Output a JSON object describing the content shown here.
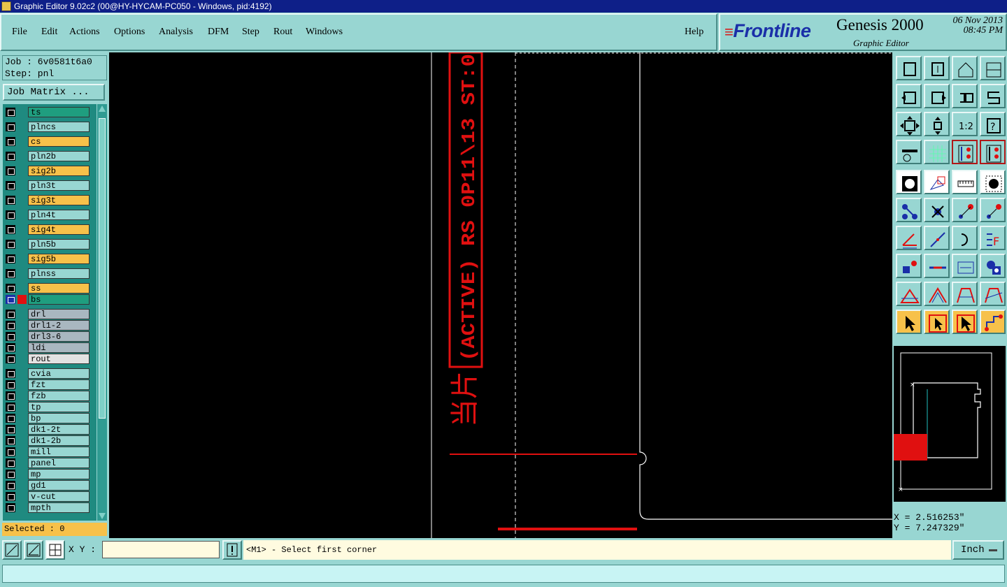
{
  "window": {
    "title": "Graphic Editor 9.02c2 (00@HY-HYCAM-PC050 - Windows, pid:4192)"
  },
  "menu": {
    "items": [
      "File",
      "Edit",
      "Actions",
      "Options",
      "Analysis",
      "DFM",
      "Step",
      "Rout",
      "Windows"
    ],
    "help": "Help"
  },
  "brand": {
    "logo": "Frontline",
    "product": "Genesis 2000",
    "date": "06 Nov 2013",
    "time": "08:45 PM",
    "subtitle": "Graphic Editor"
  },
  "job": {
    "job_label": "Job : 6v0581t6a0",
    "step_label": "Step: pnl",
    "matrix_button": "Job Matrix ..."
  },
  "layers": [
    {
      "name": "ts",
      "color": "#1f9e7f"
    },
    {
      "name": "plncs",
      "color": "#98d6d2"
    },
    {
      "name": "cs",
      "color": "#f7c14a"
    },
    {
      "name": "pln2b",
      "color": "#98d6d2"
    },
    {
      "name": "sig2b",
      "color": "#f7c14a"
    },
    {
      "name": "pln3t",
      "color": "#98d6d2"
    },
    {
      "name": "sig3t",
      "color": "#f7c14a"
    },
    {
      "name": "pln4t",
      "color": "#98d6d2"
    },
    {
      "name": "sig4t",
      "color": "#f7c14a"
    },
    {
      "name": "pln5b",
      "color": "#98d6d2"
    },
    {
      "name": "sig5b",
      "color": "#f7c14a"
    },
    {
      "name": "plnss",
      "color": "#98d6d2"
    },
    {
      "name": "ss",
      "color": "#f7c14a"
    },
    {
      "name": "bs",
      "color": "#1f9e7f",
      "active": true
    },
    {
      "name": "drl",
      "color": "#a9b7c0"
    },
    {
      "name": "drl1-2",
      "color": "#a9b7c0"
    },
    {
      "name": "drl3-6",
      "color": "#a9b7c0"
    },
    {
      "name": "ldi",
      "color": "#a9b7c0"
    },
    {
      "name": "rout",
      "color": "#e2e2e2"
    },
    {
      "name": "cvia",
      "color": "#98d6d2"
    },
    {
      "name": "fzt",
      "color": "#98d6d2"
    },
    {
      "name": "fzb",
      "color": "#98d6d2"
    },
    {
      "name": "tp",
      "color": "#98d6d2"
    },
    {
      "name": "bp",
      "color": "#98d6d2"
    },
    {
      "name": "dk1-2t",
      "color": "#98d6d2"
    },
    {
      "name": "dk1-2b",
      "color": "#98d6d2"
    },
    {
      "name": "mill",
      "color": "#98d6d2"
    },
    {
      "name": "panel",
      "color": "#98d6d2"
    },
    {
      "name": "mp",
      "color": "#98d6d2"
    },
    {
      "name": "gd1",
      "color": "#98d6d2"
    },
    {
      "name": "v-cut",
      "color": "#98d6d2"
    },
    {
      "name": "mpth",
      "color": "#98d6d2"
    }
  ],
  "selected": {
    "label": "Selected : 0"
  },
  "canvas": {
    "text_line": "(ACTIVE) RS 0P11\\13 ST:0",
    "glyph": "当片"
  },
  "coords": {
    "x": "X = 2.516253\"",
    "y": "Y = 7.247329\""
  },
  "bottom": {
    "xy_label": "X Y :",
    "xy_value": "",
    "prompt": "<M1> - Select first corner",
    "unit": "Inch"
  },
  "colors": {
    "accent": "#98d6d2",
    "feature": "#e01010",
    "highlight": "#f7c14a"
  }
}
